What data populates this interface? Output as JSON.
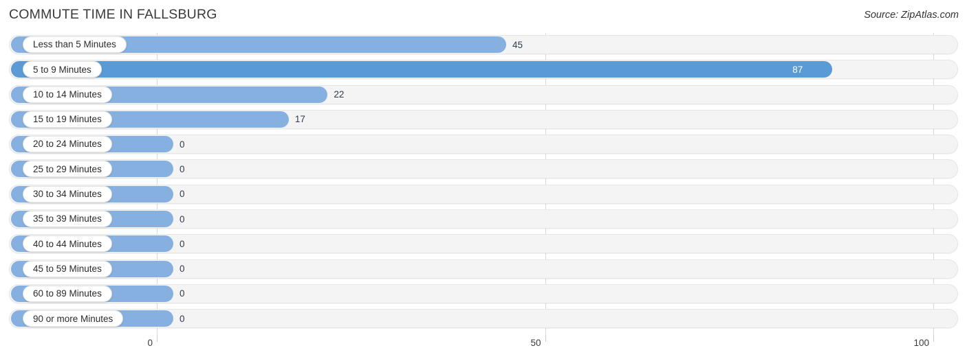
{
  "header": {
    "title": "COMMUTE TIME IN FALLSBURG",
    "source": "Source: ZipAtlas.com"
  },
  "colors": {
    "bar_default": "#86b0e0",
    "bar_highlight": "#5b9bd5",
    "track": "#f4f4f4",
    "gridline": "#d8d8d8",
    "value_text": "#2f3a4a",
    "value_text_inside": "#ffffff"
  },
  "chart_data": {
    "type": "bar",
    "orientation": "horizontal",
    "title": "COMMUTE TIME IN FALLSBURG",
    "subtitle": "",
    "xlabel": "",
    "ylabel": "",
    "xlim": [
      0,
      100
    ],
    "xticks": [
      "0",
      "50",
      "100"
    ],
    "xtick_values": [
      0,
      50,
      100
    ],
    "grid": true,
    "legend": null,
    "categories": [
      "Less than 5 Minutes",
      "5 to 9 Minutes",
      "10 to 14 Minutes",
      "15 to 19 Minutes",
      "20 to 24 Minutes",
      "25 to 29 Minutes",
      "30 to 34 Minutes",
      "35 to 39 Minutes",
      "40 to 44 Minutes",
      "45 to 59 Minutes",
      "60 to 89 Minutes",
      "90 or more Minutes"
    ],
    "values": [
      45,
      87,
      22,
      17,
      0,
      0,
      0,
      0,
      0,
      0,
      0,
      0
    ],
    "value_labels": [
      "45",
      "87",
      "22",
      "17",
      "0",
      "0",
      "0",
      "0",
      "0",
      "0",
      "0",
      "0"
    ],
    "rows": [
      {
        "label": "Less than 5 Minutes",
        "value": 45,
        "value_label": "45",
        "inside": false,
        "highlight": false
      },
      {
        "label": "5 to 9 Minutes",
        "value": 87,
        "value_label": "87",
        "inside": true,
        "highlight": true
      },
      {
        "label": "10 to 14 Minutes",
        "value": 22,
        "value_label": "22",
        "inside": false,
        "highlight": false
      },
      {
        "label": "15 to 19 Minutes",
        "value": 17,
        "value_label": "17",
        "inside": false,
        "highlight": false
      },
      {
        "label": "20 to 24 Minutes",
        "value": 0,
        "value_label": "0",
        "inside": false,
        "highlight": false
      },
      {
        "label": "25 to 29 Minutes",
        "value": 0,
        "value_label": "0",
        "inside": false,
        "highlight": false
      },
      {
        "label": "30 to 34 Minutes",
        "value": 0,
        "value_label": "0",
        "inside": false,
        "highlight": false
      },
      {
        "label": "35 to 39 Minutes",
        "value": 0,
        "value_label": "0",
        "inside": false,
        "highlight": false
      },
      {
        "label": "40 to 44 Minutes",
        "value": 0,
        "value_label": "0",
        "inside": false,
        "highlight": false
      },
      {
        "label": "45 to 59 Minutes",
        "value": 0,
        "value_label": "0",
        "inside": false,
        "highlight": false
      },
      {
        "label": "60 to 89 Minutes",
        "value": 0,
        "value_label": "0",
        "inside": false,
        "highlight": false
      },
      {
        "label": "90 or more Minutes",
        "value": 0,
        "value_label": "0",
        "inside": false,
        "highlight": false
      }
    ]
  }
}
